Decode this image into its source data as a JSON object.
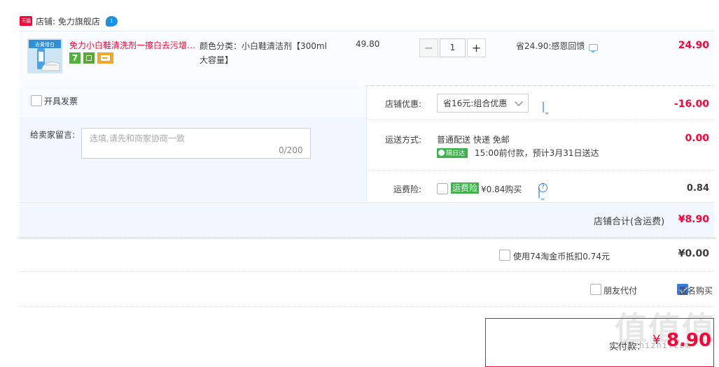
{
  "shop": {
    "badge": "天猫",
    "label": "店铺: 免力旗舰店",
    "chat_badge": "1"
  },
  "item": {
    "title": "免力小白鞋清洗剂一擦白去污增…",
    "sku": "颜色分类：小白鞋清洁剂【300ml大容量】",
    "unit_price": "49.80",
    "quantity": "1",
    "minus_label": "−",
    "plus_label": "+",
    "discount": "省24.90:感恩回馈",
    "total": "24.90",
    "service_icon_7": "7",
    "thumb_banner": "去黄增白"
  },
  "invoice": {
    "label": "开具发票"
  },
  "message": {
    "label": "给卖家留言:",
    "placeholder": "选填,请先和商家协商一致",
    "counter": "0/200"
  },
  "coupon": {
    "label": "店铺优惠:",
    "selected": "省16元:组合优惠",
    "amount": "-16.00"
  },
  "shipping": {
    "label": "运送方式:",
    "method": "普通配送 快递 免邮",
    "badge": "隔日达",
    "eta": "15:00前付款，预计3月31日送达",
    "amount": "0.00"
  },
  "insurance": {
    "label": "运费险:",
    "badge": "运费险",
    "price": "¥0.84购买",
    "help": "?",
    "amount": "0.84"
  },
  "shop_total": {
    "label": "店铺合计(含运费)",
    "amount": "¥8.90"
  },
  "coins": {
    "label": "使用74淘金币抵扣0.74元",
    "amount": "¥0.00"
  },
  "pay_options": {
    "friend": "朋友代付",
    "anonymous": "匿名购买"
  },
  "final": {
    "label": "实付款：",
    "currency": "¥",
    "amount": "8.90"
  },
  "watermark": {
    "glyphs": "值值值",
    "domain": "zhizhizhi.com"
  },
  "colors": {
    "accent": "#ff0036",
    "blue": "#3a7ae3",
    "green": "#3db24b",
    "panel": "#f2f7ff"
  }
}
